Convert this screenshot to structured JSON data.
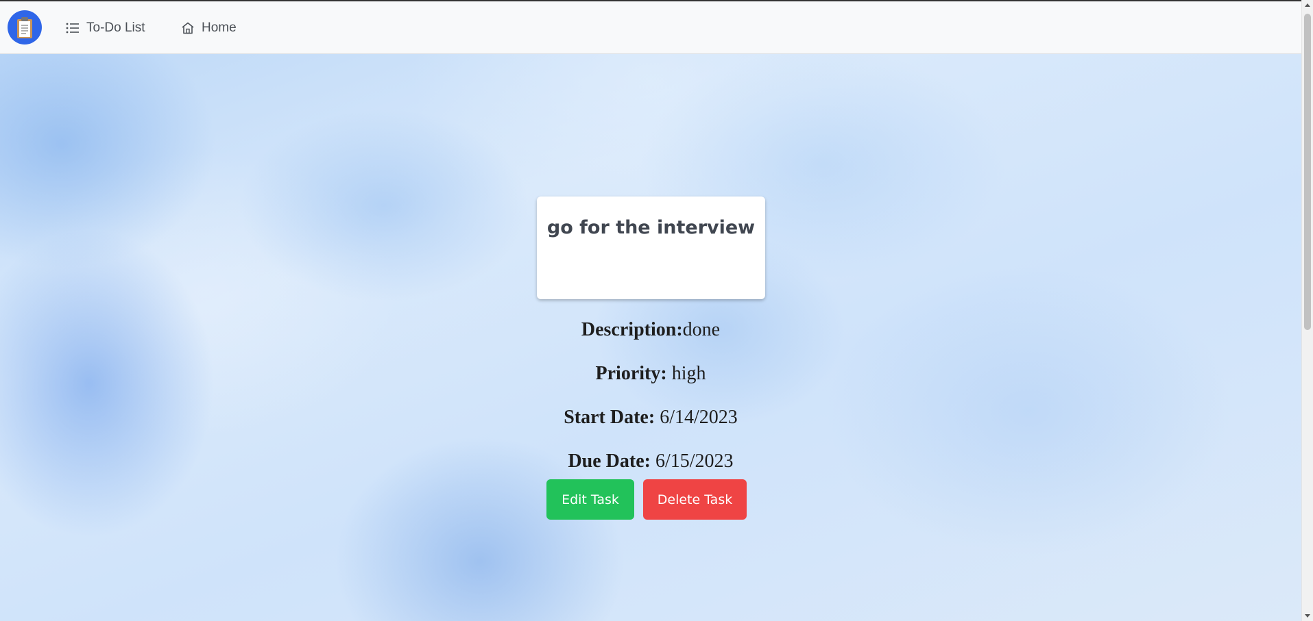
{
  "navbar": {
    "logo_icon": "clipboard-icon",
    "links": [
      {
        "label": "To-Do List",
        "icon": "list-icon"
      },
      {
        "label": "Home",
        "icon": "home-icon"
      }
    ]
  },
  "task": {
    "title": "go for the interview",
    "description_label": "Description:",
    "description": "done",
    "priority_label": "Priority:",
    "priority": "high",
    "start_label": "Start Date:",
    "start_date": "6/14/2023",
    "due_label": "Due Date:",
    "due_date": "6/15/2023"
  },
  "actions": {
    "edit_label": "Edit Task",
    "delete_label": "Delete Task"
  },
  "colors": {
    "edit": "#22c25a",
    "delete": "#ef4444",
    "logo": "#2f66e8"
  }
}
